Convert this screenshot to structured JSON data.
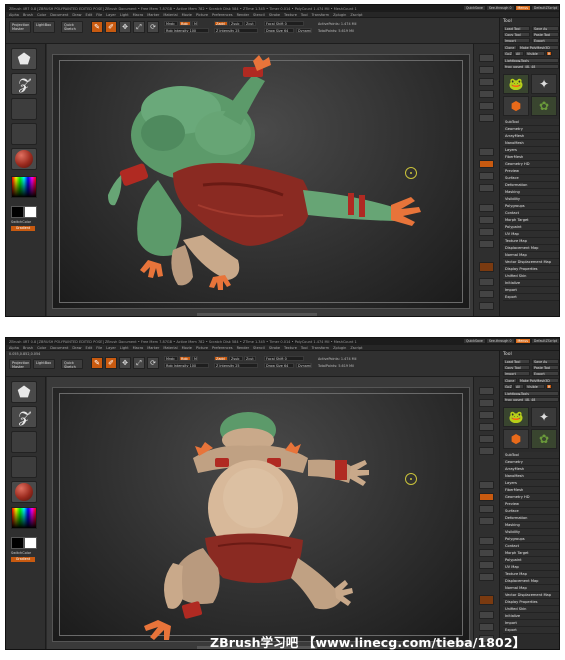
{
  "shots": [
    {
      "id": "top",
      "title_bar": "ZBrush 4R7 0.8 [ZBRUSH POLYPAINTED EDITED POSE]    ZBrush Document    • Free Mem 7.87GB • Active Mem 782 • Scratch Disk 584 • ZTime 1.345 • Timer 0.014 • PolyCount 1.474 Mil • MeshCount 1",
      "menu": [
        "Alpha",
        "Brush",
        "Color",
        "Document",
        "Draw",
        "Edit",
        "File",
        "Layer",
        "Light",
        "Macro",
        "Marker",
        "Material",
        "Movie",
        "Picture",
        "Preferences",
        "Render",
        "Stencil",
        "Stroke",
        "Texture",
        "Tool",
        "Transform",
        "Zplugin",
        "Zscript"
      ],
      "top_right": [
        "QuickSave",
        "See-through 0",
        "Menus",
        "DefaultZScript"
      ],
      "toolbar": {
        "projection_master": "Projection Master",
        "lightbox": "LightBox",
        "quick_sketch": "Quick Sketch",
        "edit": "Edit",
        "draw": "Draw",
        "move": "Move",
        "scale": "Scale",
        "rotate": "Rotate",
        "mrgb": "Mrgb",
        "rgb": "Rgb",
        "m": "M",
        "rgb_intensity": "Rgb Intensity 100",
        "zadd": "Zadd",
        "zsub": "Zsub",
        "zcut": "Zcut",
        "z_intensity": "Z Intensity 25",
        "focal_shift": "Focal Shift 0",
        "draw_size": "Draw Size 64",
        "dynamic": "Dynamic",
        "active_points": "ActivePoints: 1.474 Mil",
        "total_points": "TotalPoints: 5.619 Mil"
      },
      "left_shelf": {
        "switch_color": "SwitchColor",
        "gradient": "Gradient"
      },
      "palette": {
        "title": "Tool",
        "load_tool": "Load Tool",
        "save_as": "Save As",
        "copy_tool": "Copy Tool",
        "paste_tool": "Paste Tool",
        "import": "Import",
        "export": "Export",
        "clone": "Clone",
        "make_polymesh3d": "Make PolyMesh3D",
        "goz": "GoZ",
        "all": "All",
        "visible": "Visible",
        "r": "R",
        "lightbox_tools": "Lightbox▸Tools",
        "current_tool": "frog_posed_48. 48",
        "thumb_labels": [
          "frog_posed",
          "SimpleBrush",
          "Cylinder3D",
          "PM3D_frog"
        ],
        "menu_items": [
          "SubTool",
          "Geometry",
          "ArrayMesh",
          "NanoMesh",
          "Layers",
          "FiberMesh",
          "Geometry HD",
          "Preview",
          "Surface",
          "Deformation",
          "Masking",
          "Visibility",
          "Polygroups",
          "Contact",
          "Morph Target",
          "Polypaint",
          "UV Map",
          "Texture Map",
          "Displacement Map",
          "Normal Map",
          "Vector Displacement Map",
          "Display Properties",
          "Unified Skin",
          "Initialize",
          "Import",
          "Export"
        ]
      }
    },
    {
      "id": "bottom",
      "title_bar": "ZBrush 4R7 0.8 [ZBRUSH POLYPAINTED EDITED POSE]    ZBrush Document    • Free Mem 7.87GB • Active Mem 782 • Scratch Disk 584 • ZTime 1.345 • Timer 0.014 • PolyCount 1.474 Mil • MeshCount 1",
      "coords": "0.055,0.852,0.054"
    }
  ],
  "watermark": "ZBrush学习吧 【www.linecg.com/tieba/1802】",
  "colors": {
    "accent": "#c85a10",
    "skin_green": "#5c9a6a",
    "skin_tan": "#c9a98a",
    "cloth_red": "#8a2a22",
    "toes_orange": "#e8743a",
    "cursor_yellow": "#c9c23a"
  }
}
